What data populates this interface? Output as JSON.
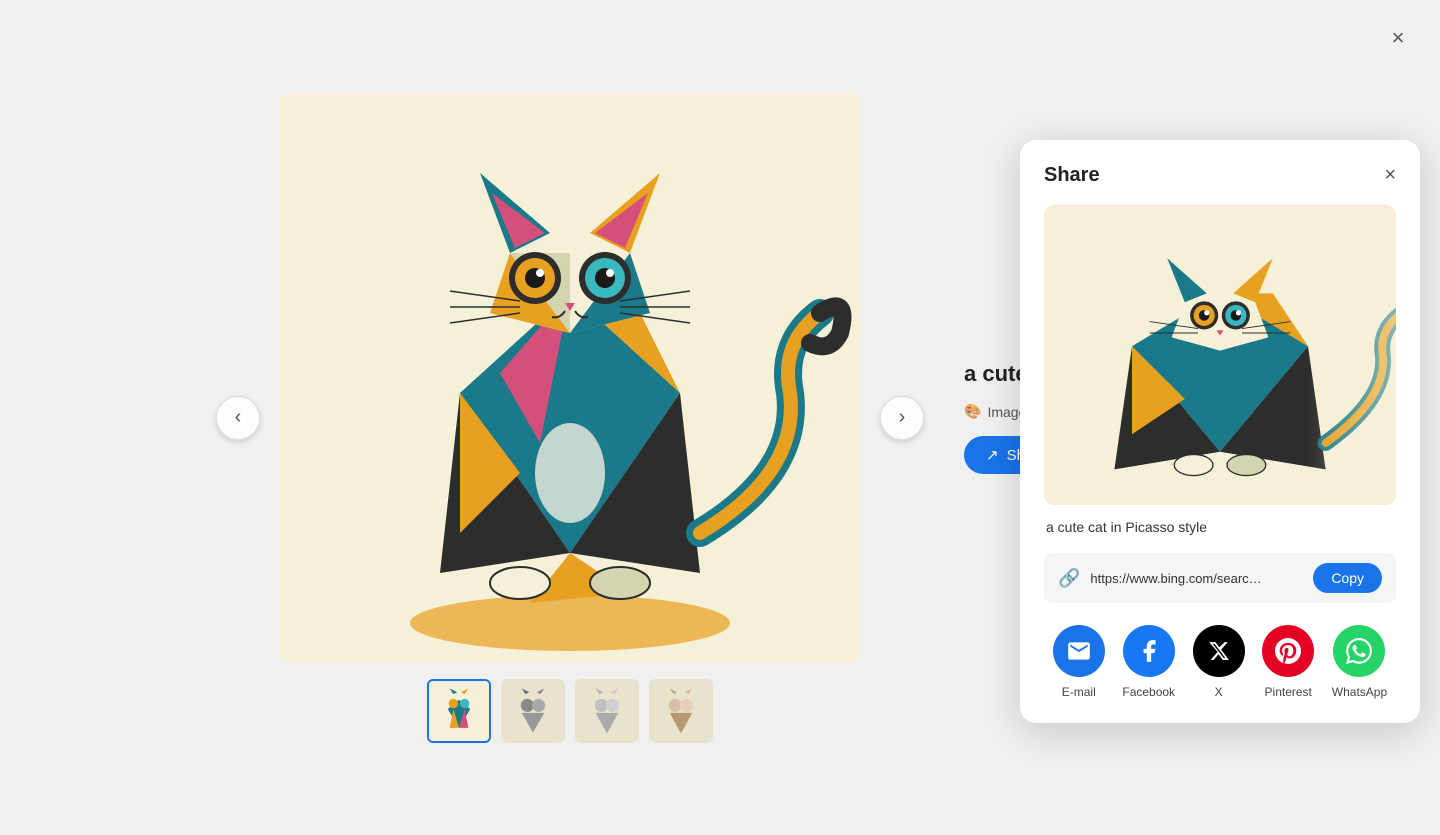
{
  "page": {
    "background_color": "#f0f0f0"
  },
  "main": {
    "close_label": "×",
    "prev_arrow": "‹",
    "next_arrow": "›"
  },
  "image": {
    "title": "a cute cat i…",
    "creator": "Image Creator i…",
    "caption": "a cute cat in Picasso style"
  },
  "share_button": {
    "label": "Share",
    "icon": "share"
  },
  "share_panel": {
    "title": "Share",
    "close_label": "×",
    "url": "https://www.bing.com/searc…",
    "copy_label": "Copy",
    "caption": "a cute cat in Picasso style",
    "social_items": [
      {
        "id": "email",
        "label": "E-mail",
        "icon_type": "email"
      },
      {
        "id": "facebook",
        "label": "Facebook",
        "icon_type": "facebook"
      },
      {
        "id": "x",
        "label": "X",
        "icon_type": "x"
      },
      {
        "id": "pinterest",
        "label": "Pinterest",
        "icon_type": "pinterest"
      },
      {
        "id": "whatsapp",
        "label": "WhatsApp",
        "icon_type": "whatsapp"
      }
    ]
  },
  "thumbnails": [
    {
      "id": "thumb1",
      "active": true
    },
    {
      "id": "thumb2",
      "active": false
    },
    {
      "id": "thumb3",
      "active": false
    },
    {
      "id": "thumb4",
      "active": false
    }
  ]
}
